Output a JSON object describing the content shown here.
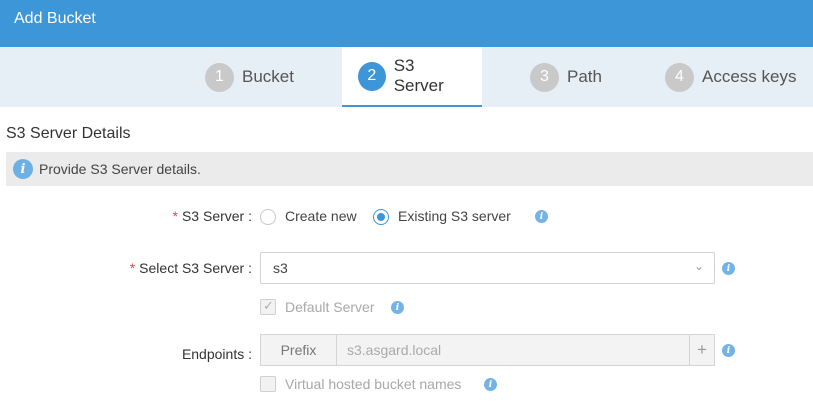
{
  "window": {
    "title": "Add Bucket"
  },
  "steps": [
    {
      "num": "1",
      "label": "Bucket"
    },
    {
      "num": "2",
      "label": "S3 Server",
      "active": true
    },
    {
      "num": "3",
      "label": "Path"
    },
    {
      "num": "4",
      "label": "Access keys"
    }
  ],
  "section": {
    "title": "S3 Server Details",
    "info": "Provide S3 Server details."
  },
  "form": {
    "s3_server": {
      "label": "S3 Server :",
      "options": [
        "Create new",
        "Existing S3 server"
      ],
      "selected": "Existing S3 server"
    },
    "select_s3_server": {
      "label": "Select S3 Server :",
      "value": "s3"
    },
    "default_server": {
      "label": "Default Server",
      "checked": true,
      "disabled": true
    },
    "endpoints": {
      "label": "Endpoints :",
      "prefix": "Prefix",
      "value": "s3.asgard.local"
    },
    "virtual_hosted": {
      "label": "Virtual hosted bucket names",
      "checked": false,
      "disabled": true
    }
  },
  "icons": {
    "info": "info-icon",
    "chevron": "chevron-down-icon",
    "add": "plus-icon"
  },
  "colors": {
    "brand": "#3d96d8",
    "required": "#e14a4a",
    "info": "#74b3e6"
  }
}
